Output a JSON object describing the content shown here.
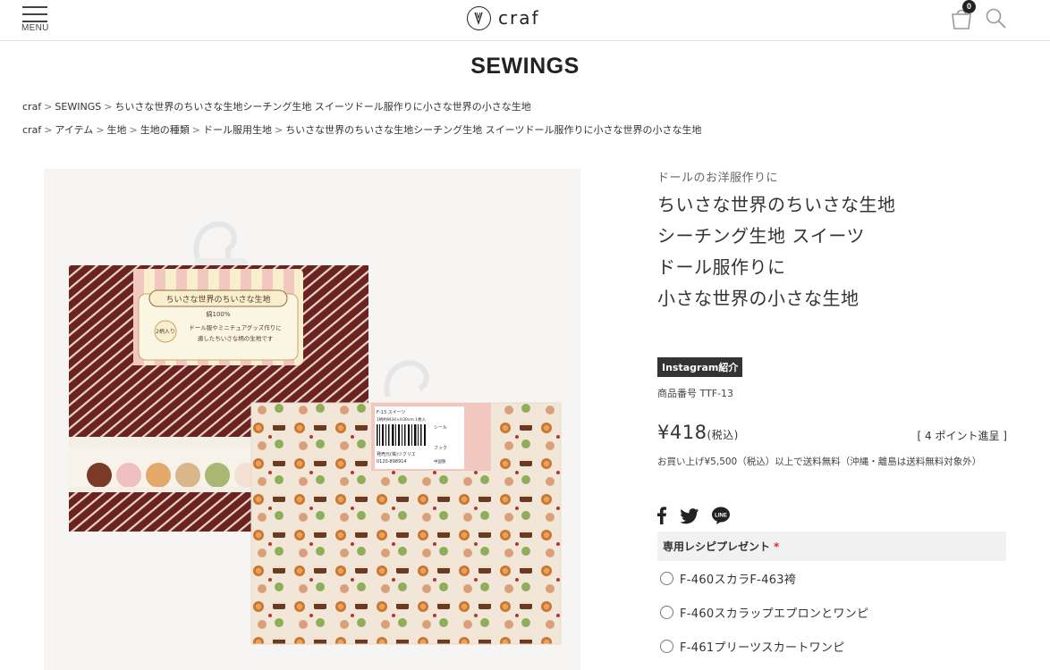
{
  "header": {
    "menu_label": "MENU",
    "logo_text": "craf",
    "cart_count": "0"
  },
  "page_title": "SEWINGS",
  "breadcrumb1": [
    "craf",
    "SEWINGS",
    "ちいさな世界のちいさな生地シーチング生地 スイーツドール服作りに小さな世界の小さな生地"
  ],
  "breadcrumb2": [
    "craf",
    "アイテム",
    "生地",
    "生地の種類",
    "ドール服用生地",
    "ちいさな世界のちいさな生地シーチング生地 スイーツドール服作りに小さな世界の小さな生地"
  ],
  "product": {
    "subtitle": "ドールのお洋服作りに",
    "title_lines": [
      "ちいさな世界のちいさな生地",
      "シーチング生地 スイーツ",
      "ドール服作りに",
      "小さな世界の小さな生地"
    ],
    "instagram_label": "Instagram紹介",
    "code": "商品番号 TTF-13",
    "price": "¥418",
    "price_tax": "(税込)",
    "points": "[ 4 ポイント進呈 ]",
    "shipping": "お買い上げ¥5,500（税込）以上で送料無料（沖縄・離島は送料無料対象外）"
  },
  "image_package": {
    "label_title": "ちいさな世界のちいさな生地",
    "cotton": "綿100%",
    "count": "2柄入り",
    "desc_line1": "ドール服やミニチュアグッズ作りに",
    "desc_line2": "適したちいさな柄の生地です",
    "tag_code": "F-13 スイーツ",
    "tag_size": "1柄約W34×H30cm 1枚入",
    "tag_maker": "発売元(株)ツクリエ",
    "tag_phone": "0120-898914",
    "tag_seal": "シール",
    "tag_hook": "フック",
    "tag_origin": "中国製"
  },
  "options": {
    "heading": "専用レシピプレゼント",
    "required_mark": "*",
    "items": [
      "F-460スカラF-463袴",
      "F-460スカラップエプロンとワンピ",
      "F-461プリーツスカートワンピ"
    ]
  },
  "colors": {
    "fabric_brown": "#6b2320",
    "fabric_cream": "#f1e6d8",
    "label_pink": "#f2c7c0",
    "label_cream": "#f8efcf"
  }
}
